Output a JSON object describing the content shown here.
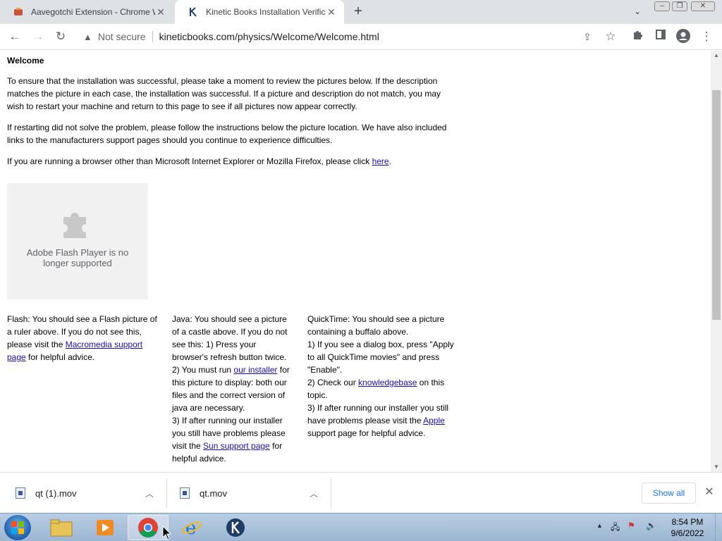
{
  "browser": {
    "tabs": [
      {
        "title": "Aavegotchi Extension - Chrome W",
        "icon": "extension-favicon"
      },
      {
        "title": "Kinetic Books Installation Verificat",
        "icon": "kinetic-books-favicon"
      }
    ],
    "address": {
      "security": "Not secure",
      "url": "kineticbooks.com/physics/Welcome/Welcome.html"
    }
  },
  "page": {
    "heading": "Welcome",
    "para1": "To ensure that the installation was successful, please take a moment to review the pictures below. If the description matches the picture in each case, the installation was successful. If a picture and description do not match, you may wish to restart your machine and return to this page to see if all pictures now appear correctly.",
    "para2": "If restarting did not solve the problem, please follow the instructions below the picture location. We have also included links to the manufacturers support pages should you continue to experience difficulties.",
    "para3_pre": "If you are running a browser other than Microsoft Internet Explorer or Mozilla Firefox, please click ",
    "para3_link": "here",
    "para3_post": ".",
    "flash_message": "Adobe Flash Player is no longer supported",
    "flash": {
      "pre": "Flash: You should see a Flash picture of a ruler above. If you do not see this, please visit the ",
      "link": "Macromedia support page",
      "post": " for helpful advice."
    },
    "java": {
      "p1": "Java: You should see a picture of a castle above. If you do not see this: 1) Press your browser's refresh button twice.",
      "p2_pre": "2) You must run ",
      "p2_link": "our installer",
      "p2_post": " for this picture to display: both our files and the correct version of java are necessary.",
      "p3_pre": "3) If after running our installer you still have problems please visit the ",
      "p3_link": "Sun support page",
      "p3_post": " for helpful advice."
    },
    "quicktime": {
      "p1": "QuickTime: You should see a picture containing a buffalo above.",
      "p2": "1) If you see a dialog box, press \"Apply to all QuickTime movies\" and press \"Enable\".",
      "p3_pre": "2) Check our ",
      "p3_link": "knowledgebase",
      "p3_post": " on this topic.",
      "p4_pre": "3) If after running our installer you still have problems please visit the ",
      "p4_link": "Apple",
      "p4_post": " support page for helpful advice."
    }
  },
  "downloads": {
    "items": [
      {
        "name": "qt (1).mov"
      },
      {
        "name": "qt.mov"
      }
    ],
    "show_all": "Show all"
  },
  "taskbar": {
    "time": "8:54 PM",
    "date": "9/6/2022"
  },
  "colors": {
    "link": "#1a0dab",
    "accent": "#1a73e8"
  }
}
